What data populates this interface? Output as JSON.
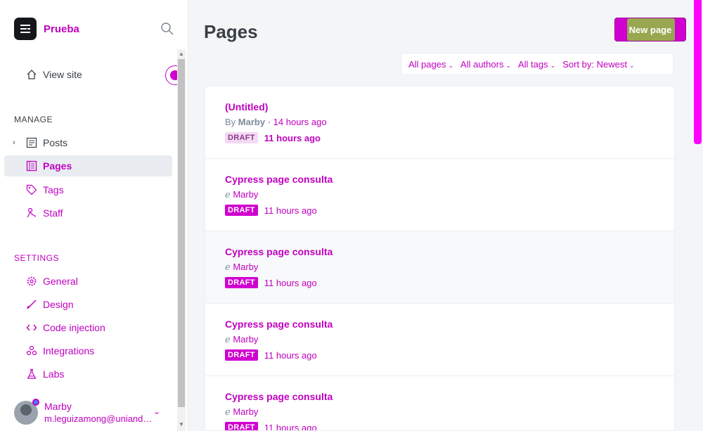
{
  "brand": {
    "name": "Prueba"
  },
  "sidebar": {
    "view_site": "View site",
    "manage_title": "MANAGE",
    "manage_items": [
      {
        "label": "Posts",
        "icon": "posts-icon"
      },
      {
        "label": "Pages",
        "icon": "pages-icon"
      },
      {
        "label": "Tags",
        "icon": "tag-icon"
      },
      {
        "label": "Staff",
        "icon": "staff-icon"
      }
    ],
    "settings_title": "SETTINGS",
    "settings_items": [
      {
        "label": "General",
        "icon": "gear-icon"
      },
      {
        "label": "Design",
        "icon": "brush-icon"
      },
      {
        "label": "Code injection",
        "icon": "code-icon"
      },
      {
        "label": "Integrations",
        "icon": "integrations-icon"
      },
      {
        "label": "Labs",
        "icon": "flask-icon"
      }
    ]
  },
  "user": {
    "name": "Marby",
    "email": "m.leguizamong@uniandes.edu.co"
  },
  "main": {
    "title": "Pages",
    "new_button": "New page",
    "filters": [
      "All pages",
      "All authors",
      "All tags",
      "Sort by: Newest"
    ]
  },
  "pages": [
    {
      "title": "(Untitled)",
      "author": "Marby",
      "time_ago": "14 hours ago",
      "status": "DRAFT",
      "status_time": "11 hours ago"
    },
    {
      "title": "Cypress page consulta",
      "author": "Marby",
      "status": "DRAFT",
      "status_time": "11 hours ago"
    },
    {
      "title": "Cypress page consulta",
      "author": "Marby",
      "status": "DRAFT",
      "status_time": "11 hours ago"
    },
    {
      "title": "Cypress page consulta",
      "author": "Marby",
      "status": "DRAFT",
      "status_time": "11 hours ago"
    },
    {
      "title": "Cypress page consulta",
      "author": "Marby",
      "status": "DRAFT",
      "status_time": "11 hours ago"
    }
  ],
  "colors": {
    "accent": "#c000c0",
    "badge": "#d000d0",
    "button_green": "#8fc43a"
  }
}
